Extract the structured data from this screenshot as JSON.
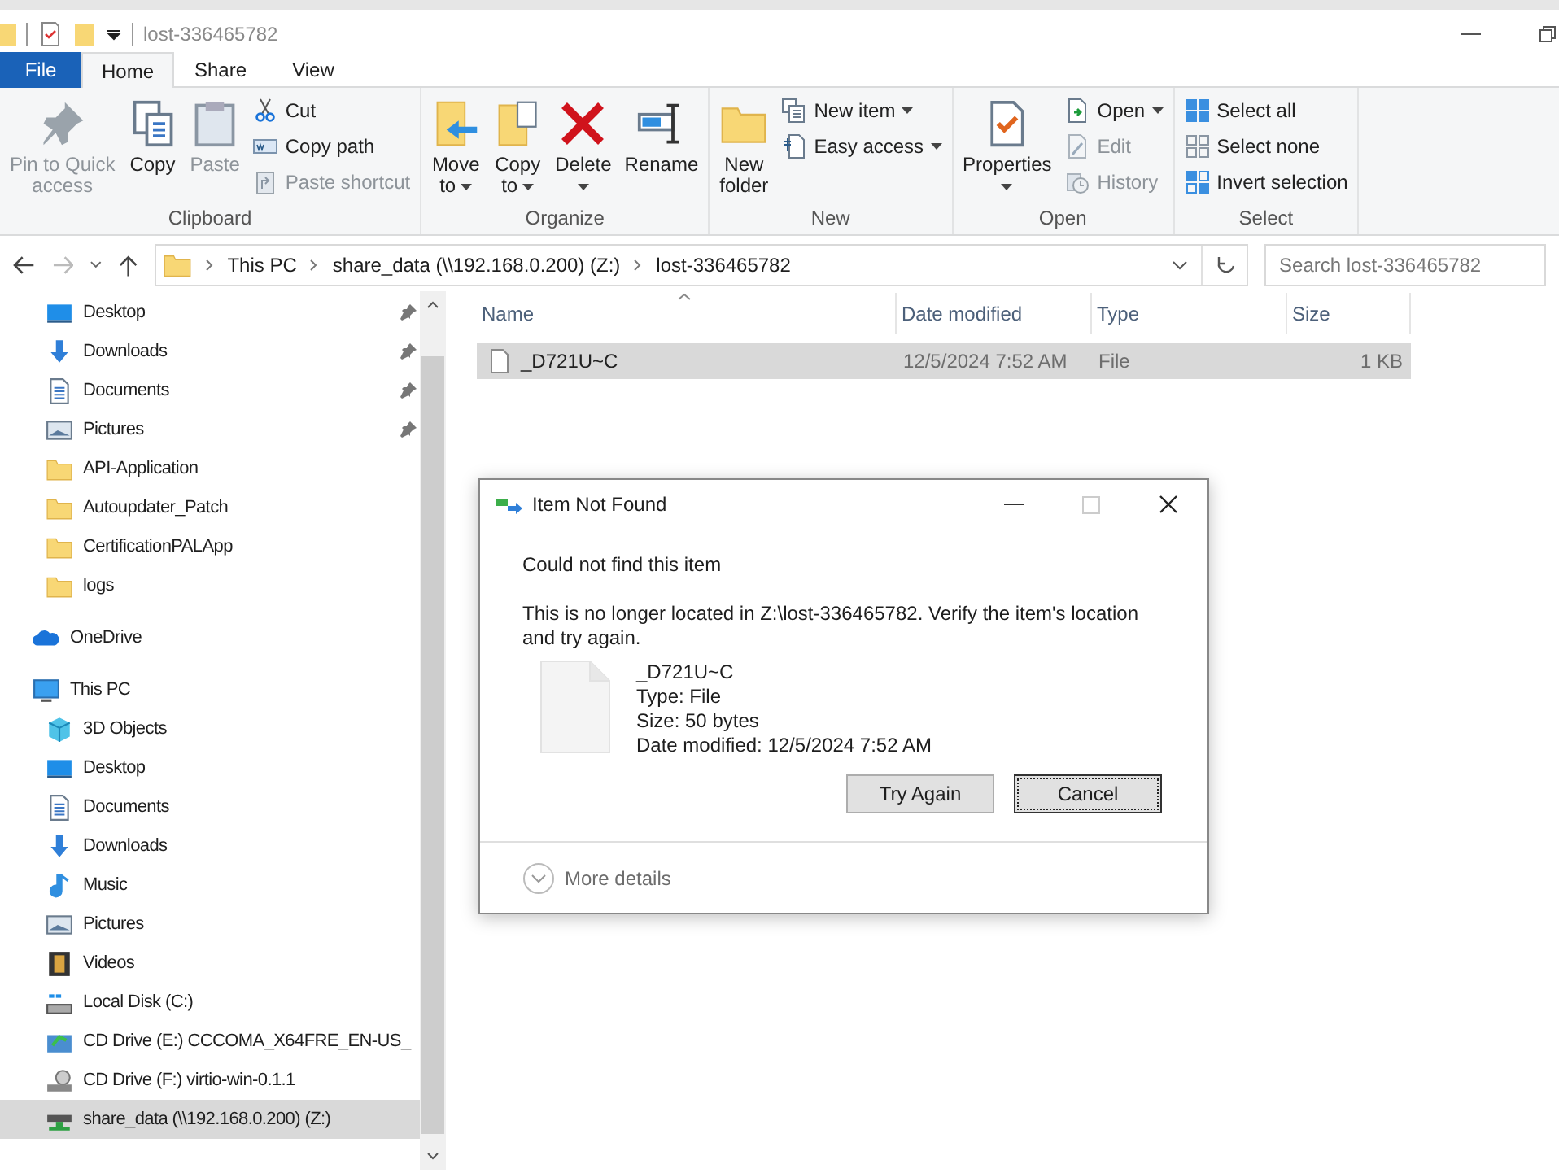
{
  "window": {
    "title": "lost-336465782"
  },
  "ribbon_tabs": [
    {
      "label": "File",
      "kind": "file",
      "selected": false
    },
    {
      "label": "Home",
      "kind": "tab",
      "selected": true
    },
    {
      "label": "Share",
      "kind": "tab",
      "selected": false
    },
    {
      "label": "View",
      "kind": "tab",
      "selected": false
    }
  ],
  "ribbon_groups": [
    {
      "label": "Clipboard",
      "large": [
        {
          "label": "Pin to Quick access",
          "disabled": true,
          "dropdown": false
        },
        {
          "label": "Copy",
          "disabled": false,
          "dropdown": false
        },
        {
          "label": "Paste",
          "disabled": true,
          "dropdown": false
        }
      ],
      "small": [
        {
          "label": "Cut",
          "disabled": false,
          "dropdown": false
        },
        {
          "label": "Copy path",
          "disabled": false,
          "dropdown": false
        },
        {
          "label": "Paste shortcut",
          "disabled": true,
          "dropdown": false
        }
      ]
    },
    {
      "label": "Organize",
      "large": [
        {
          "label": "Move to",
          "disabled": false,
          "dropdown": true
        },
        {
          "label": "Copy to",
          "disabled": false,
          "dropdown": true
        },
        {
          "label": "Delete",
          "disabled": false,
          "dropdown": true
        },
        {
          "label": "Rename",
          "disabled": false,
          "dropdown": false
        }
      ]
    },
    {
      "label": "New",
      "large": [
        {
          "label": "New folder",
          "disabled": false,
          "dropdown": false
        }
      ],
      "small": [
        {
          "label": "New item",
          "disabled": false,
          "dropdown": true
        },
        {
          "label": "Easy access",
          "disabled": false,
          "dropdown": true
        }
      ]
    },
    {
      "label": "Open",
      "large": [
        {
          "label": "Properties",
          "disabled": false,
          "dropdown": true
        }
      ],
      "small": [
        {
          "label": "Open",
          "disabled": false,
          "dropdown": true
        },
        {
          "label": "Edit",
          "disabled": true,
          "dropdown": false
        },
        {
          "label": "History",
          "disabled": true,
          "dropdown": false
        }
      ]
    },
    {
      "label": "Select",
      "small": [
        {
          "label": "Select all",
          "disabled": false,
          "dropdown": false
        },
        {
          "label": "Select none",
          "disabled": false,
          "dropdown": false
        },
        {
          "label": "Invert selection",
          "disabled": false,
          "dropdown": false
        }
      ]
    }
  ],
  "address_bar": {
    "breadcrumbs": [
      "This PC",
      "share_data (\\\\192.168.0.200) (Z:)",
      "lost-336465782"
    ]
  },
  "search": {
    "placeholder": "Search lost-336465782"
  },
  "sidebar": {
    "quick_access": [
      {
        "label": "Desktop",
        "pinned": true
      },
      {
        "label": "Downloads",
        "pinned": true
      },
      {
        "label": "Documents",
        "pinned": true
      },
      {
        "label": "Pictures",
        "pinned": true
      },
      {
        "label": "API-Application",
        "pinned": false
      },
      {
        "label": "Autoupdater_Patch",
        "pinned": false
      },
      {
        "label": "CertificationPALApp",
        "pinned": false
      },
      {
        "label": "logs",
        "pinned": false
      }
    ],
    "items": [
      {
        "label": "OneDrive",
        "selected": false
      },
      {
        "label": "This PC",
        "selected": false,
        "children": [
          {
            "label": "3D Objects",
            "selected": false
          },
          {
            "label": "Desktop",
            "selected": false
          },
          {
            "label": "Documents",
            "selected": false
          },
          {
            "label": "Downloads",
            "selected": false
          },
          {
            "label": "Music",
            "selected": false
          },
          {
            "label": "Pictures",
            "selected": false
          },
          {
            "label": "Videos",
            "selected": false
          },
          {
            "label": "Local Disk (C:)",
            "selected": false
          },
          {
            "label": "CD Drive (E:) CCCOMA_X64FRE_EN-US_",
            "selected": false
          },
          {
            "label": "CD Drive (F:) virtio-win-0.1.1",
            "selected": false
          },
          {
            "label": "share_data (\\\\192.168.0.200) (Z:)",
            "selected": true
          }
        ]
      }
    ]
  },
  "file_list": {
    "columns": [
      "Name",
      "Date modified",
      "Type",
      "Size"
    ],
    "rows": [
      {
        "cells": [
          "_D721U~C",
          "12/5/2024 7:52 AM",
          "File",
          "1 KB"
        ],
        "selected": true
      }
    ]
  },
  "dialog": {
    "title": "Item Not Found",
    "heading": "Could not find this item",
    "message": "This is no longer located in Z:\\lost-336465782. Verify the item's location and try again.",
    "file_details": [
      "_D721U~C",
      "Type: File",
      "Size: 50 bytes",
      "Date modified: 12/5/2024 7:52 AM"
    ],
    "buttons": [
      {
        "label": "Try Again",
        "focused": false
      },
      {
        "label": "Cancel",
        "focused": true
      }
    ],
    "more_details": "More details"
  }
}
